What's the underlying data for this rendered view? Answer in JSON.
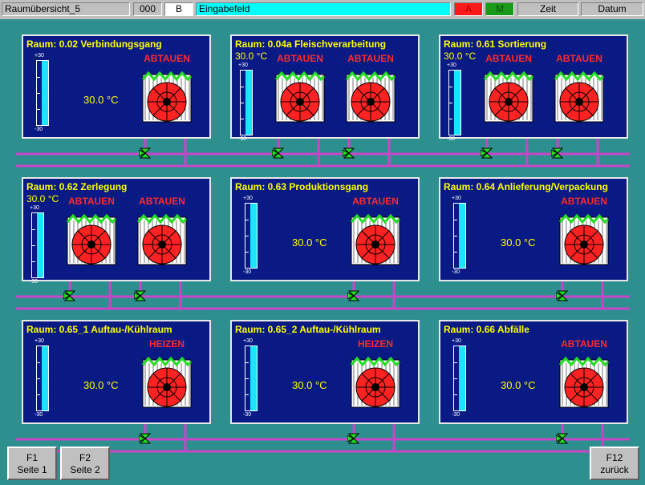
{
  "topbar": {
    "window_title": "Raumübersicht_5",
    "counter": "000",
    "mode": "B",
    "input_label": "Eingabefeld",
    "alarm_a": "A",
    "alarm_m": "M",
    "time_label": "Zeit",
    "date_label": "Datum"
  },
  "colors": {
    "background": "#2e8f8f",
    "panel": "#0a1a85",
    "title_text": "#ffff00",
    "status_text": "#ff2a2a",
    "pipe": "#c846c8",
    "gauge_fill": "#19e5ff",
    "alarm_a": "#ff1a1a",
    "alarm_m": "#1a9a1a",
    "input_field": "#00ffff"
  },
  "gauge": {
    "max_label": "+30",
    "min_label": "-30"
  },
  "rooms": [
    {
      "title": "Raum: 0.02 Verbindungsgang",
      "temp": "30.0 °C",
      "statuses": [
        "ABTAUEN"
      ]
    },
    {
      "title": "Raum: 0.04a Fleischverarbeitung",
      "temp": "30.0 °C",
      "statuses": [
        "ABTAUEN",
        "ABTAUEN"
      ]
    },
    {
      "title": "Raum: 0.61 Sortierung",
      "temp": "30.0 °C",
      "statuses": [
        "ABTAUEN",
        "ABTAUEN"
      ]
    },
    {
      "title": "Raum: 0.62 Zerlegung",
      "temp": "30.0 °C",
      "statuses": [
        "ABTAUEN",
        "ABTAUEN"
      ]
    },
    {
      "title": "Raum: 0.63 Produktionsgang",
      "temp": "30.0 °C",
      "statuses": [
        "ABTAUEN"
      ]
    },
    {
      "title": "Raum: 0.64 Anlieferung/Verpackung",
      "temp": "30.0 °C",
      "statuses": [
        "ABTAUEN"
      ]
    },
    {
      "title": "Raum: 0.65_1 Auftau-/Kühlraum",
      "temp": "30.0 °C",
      "statuses": [
        "HEIZEN"
      ]
    },
    {
      "title": "Raum: 0.65_2 Auftau-/Kühlraum",
      "temp": "30.0 °C",
      "statuses": [
        "HEIZEN"
      ]
    },
    {
      "title": "Raum: 0.66 Abfälle",
      "temp": "30.0 °C",
      "statuses": [
        "ABTAUEN"
      ]
    }
  ],
  "fkeys": {
    "f1_key": "F1",
    "f1_label": "Seite 1",
    "f2_key": "F2",
    "f2_label": "Seite 2",
    "f12_key": "F12",
    "f12_label": "zurück"
  }
}
